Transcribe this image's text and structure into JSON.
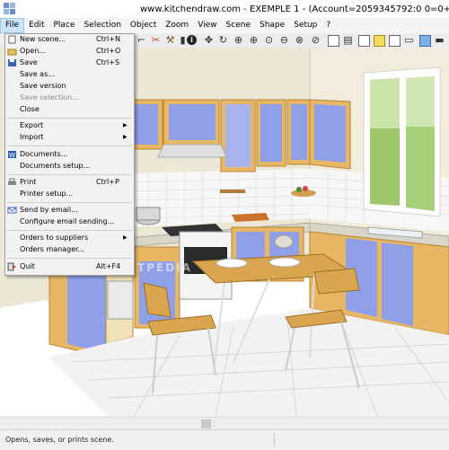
{
  "window": {
    "title": "www.kitchendraw.com - EXEMPLE 1 - (Account=2059345792:0 0=0+"
  },
  "menubar": {
    "items": [
      "File",
      "Edit",
      "Place",
      "Selection",
      "Object",
      "Zoom",
      "View",
      "Scene",
      "Shape",
      "Setup",
      "?"
    ]
  },
  "file_menu": {
    "new_scene": {
      "label": "New scene...",
      "shortcut": "Ctrl+N"
    },
    "open": {
      "label": "Open...",
      "shortcut": "Ctrl+O"
    },
    "save": {
      "label": "Save",
      "shortcut": "Ctrl+S"
    },
    "save_as": {
      "label": "Save as..."
    },
    "save_version": {
      "label": "Save version"
    },
    "save_selection": {
      "label": "Save selection..."
    },
    "close": {
      "label": "Close"
    },
    "export": {
      "label": "Export"
    },
    "import": {
      "label": "Import"
    },
    "documents": {
      "label": "Documents..."
    },
    "documents_setup": {
      "label": "Documents setup..."
    },
    "print": {
      "label": "Print",
      "shortcut": "Ctrl+P"
    },
    "printer_setup": {
      "label": "Printer setup..."
    },
    "send_by_email": {
      "label": "Send by email..."
    },
    "configure_email": {
      "label": "Configure email sending..."
    },
    "orders_to_suppliers": {
      "label": "Orders to suppliers"
    },
    "orders_manager": {
      "label": "Orders manager..."
    },
    "quit": {
      "label": "Quit",
      "shortcut": "Alt+F4"
    }
  },
  "status": {
    "text": "Opens, saves, or prints scene."
  },
  "watermark": {
    "text": "SOFTPEDIA"
  },
  "colors": {
    "cabinet_door": "#8f9fe8",
    "cabinet_frame": "#e8b765",
    "menu_highlight": "#cce4f7"
  }
}
